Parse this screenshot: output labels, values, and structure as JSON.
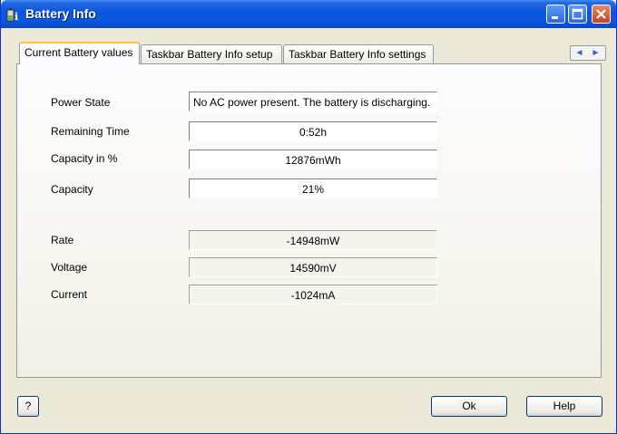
{
  "window": {
    "title": "Battery Info"
  },
  "tabs": [
    {
      "label": "Current Battery values",
      "active": true
    },
    {
      "label": "Taskbar Battery Info setup",
      "active": false
    },
    {
      "label": "Taskbar Battery Info settings",
      "active": false
    }
  ],
  "fields": {
    "power_state": {
      "label": "Power State",
      "value": "No AC power present. The battery is discharging."
    },
    "remaining_time": {
      "label": "Remaining Time",
      "value": "0:52h"
    },
    "capacity_pct": {
      "label": "Capacity in %",
      "value": "12876mWh"
    },
    "capacity": {
      "label": "Capacity",
      "value": "21%"
    },
    "rate": {
      "label": "Rate",
      "value": "-14948mW"
    },
    "voltage": {
      "label": "Voltage",
      "value": "14590mV"
    },
    "current": {
      "label": "Current",
      "value": "-1024mA"
    }
  },
  "buttons": {
    "help_question": "?",
    "ok": "Ok",
    "help": "Help"
  },
  "colors": {
    "titlebar": "#0a55dd",
    "active_tab_accent": "#ffc83c",
    "close_button": "#c9411d"
  }
}
